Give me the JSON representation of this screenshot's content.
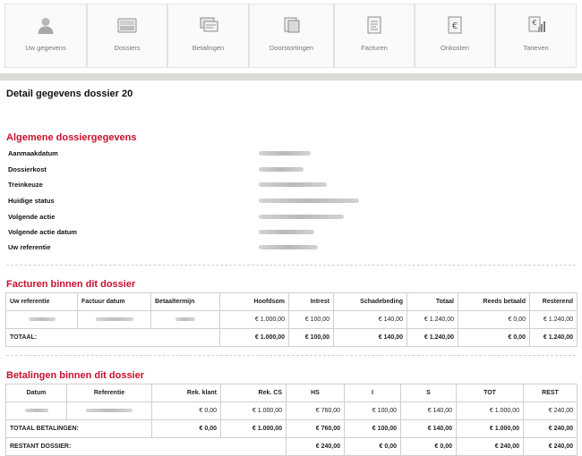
{
  "nav": {
    "items": [
      {
        "label": "Uw gegevens",
        "icon": "user-icon"
      },
      {
        "label": "Dossiers",
        "icon": "dossiers-icon"
      },
      {
        "label": "Betalingen",
        "icon": "payments-icon"
      },
      {
        "label": "Doorstortingen",
        "icon": "transfers-icon"
      },
      {
        "label": "Facturen",
        "icon": "invoices-icon"
      },
      {
        "label": "Onkosten",
        "icon": "euro-document-icon"
      },
      {
        "label": "Tarieven",
        "icon": "rates-chart-icon"
      }
    ]
  },
  "page_title": "Detail gegevens dossier 20",
  "general": {
    "title": "Algemene dossiergegevens",
    "fields": [
      {
        "label": "Aanmaakdatum"
      },
      {
        "label": "Dossierkost"
      },
      {
        "label": "Treinkeuze"
      },
      {
        "label": "Huidige status"
      },
      {
        "label": "Volgende actie"
      },
      {
        "label": "Volgende actie datum"
      },
      {
        "label": "Uw referentie"
      }
    ]
  },
  "invoices": {
    "title": "Facturen binnen dit dossier",
    "headers": [
      "Uw referentie",
      "Factuur datum",
      "Betaaltermijn",
      "Hoofdsom",
      "Intrest",
      "Schadebeding",
      "Totaal",
      "Reeds betaald",
      "Resterend"
    ],
    "row": [
      "",
      "",
      "",
      "€ 1.000,00",
      "€ 100,00",
      "€ 140,00",
      "€ 1.240,00",
      "€ 0,00",
      "€ 1.240,00"
    ],
    "total": {
      "label": "TOTAAL:",
      "values": [
        "€ 1.000,00",
        "€ 100,00",
        "€ 140,00",
        "€ 1.240,00",
        "€ 0,00",
        "€ 1.240,00"
      ]
    }
  },
  "payments": {
    "title": "Betalingen binnen dit dossier",
    "headers": [
      "Datum",
      "Referentie",
      "Rek. klant",
      "Rek. CS",
      "HS",
      "I",
      "S",
      "TOT",
      "REST"
    ],
    "row": [
      "",
      "",
      "€ 0,00",
      "€ 1.000,00",
      "€ 760,00",
      "€ 100,00",
      "€ 140,00",
      "€ 1.000,00",
      "€ 240,00"
    ],
    "total": {
      "label": "TOTAAL BETALINGEN:",
      "values": [
        "€ 0,00",
        "€ 1.000,00",
        "€ 760,00",
        "€ 100,00",
        "€ 140,00",
        "€ 1.000,00",
        "€ 240,00"
      ]
    },
    "rest": {
      "label": "RESTANT DOSSIER:",
      "values": [
        "€ 240,00",
        "€ 0,00",
        "€ 0,00",
        "€ 240,00",
        "€ 240,00"
      ]
    }
  }
}
